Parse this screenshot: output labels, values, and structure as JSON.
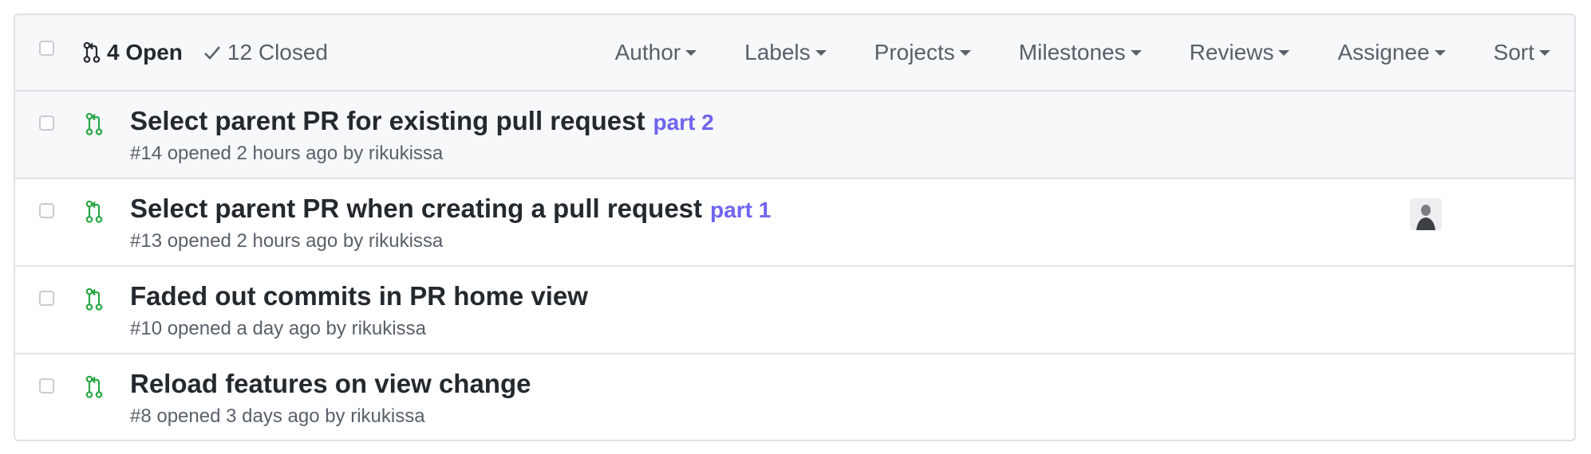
{
  "header": {
    "open_label": "4 Open",
    "closed_label": "12 Closed",
    "filters": [
      "Author",
      "Labels",
      "Projects",
      "Milestones",
      "Reviews",
      "Assignee",
      "Sort"
    ]
  },
  "pull_requests": [
    {
      "title": "Select parent PR for existing pull request",
      "label": "part 2",
      "meta": "#14 opened 2 hours ago by rikukissa"
    },
    {
      "title": "Select parent PR when creating a pull request",
      "label": "part 1",
      "meta": "#13 opened 2 hours ago by rikukissa"
    },
    {
      "title": "Faded out commits in PR home view",
      "label": "",
      "meta": "#10 opened a day ago by rikukissa"
    },
    {
      "title": "Reload features on view change",
      "label": "",
      "meta": "#8 opened 3 days ago by rikukissa"
    }
  ],
  "colors": {
    "open_icon": "#28a745",
    "label": "#6f64ee",
    "header_bg": "#f6f8fa",
    "border": "#dfe2e5"
  },
  "icons": {
    "open": "git-pull-request-icon",
    "closed": "check-icon",
    "row": "git-pull-request-icon",
    "avatar": "avatar"
  }
}
